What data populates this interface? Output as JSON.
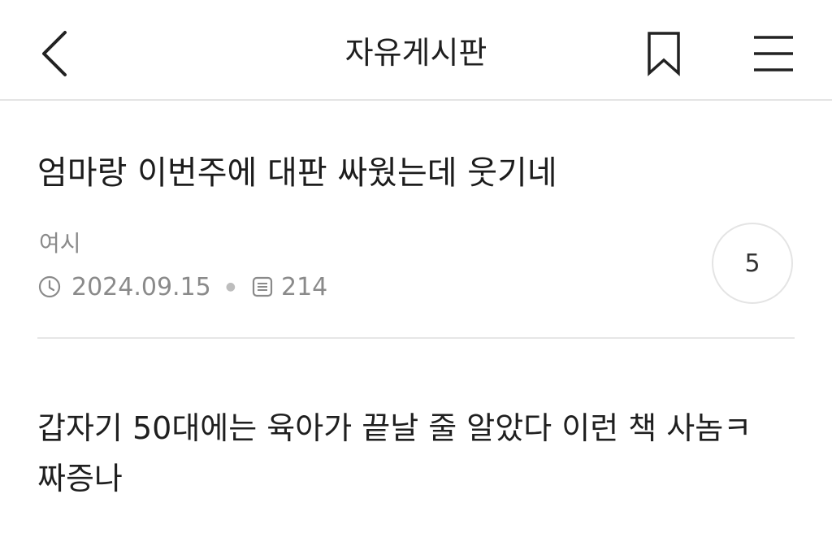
{
  "header": {
    "title": "자유게시판"
  },
  "post": {
    "title": "엄마랑 이번주에 대판 싸웠는데 웃기네",
    "author": "여시",
    "date": "2024.09.15",
    "views": "214",
    "comment_count": "5",
    "body_line1": "갑자기 50대에는 육아가 끝날 줄 알았다 이런 책 사놈ㅋ",
    "body_line2": "짜증나"
  },
  "icons": {
    "back": "chevron-left-icon",
    "bookmark": "bookmark-icon",
    "menu": "hamburger-menu-icon",
    "clock": "clock-icon",
    "views": "document-list-icon"
  },
  "colors": {
    "text_primary": "#1f1f1f",
    "text_meta": "#8a8a8a",
    "divider": "#e4e4e4"
  }
}
